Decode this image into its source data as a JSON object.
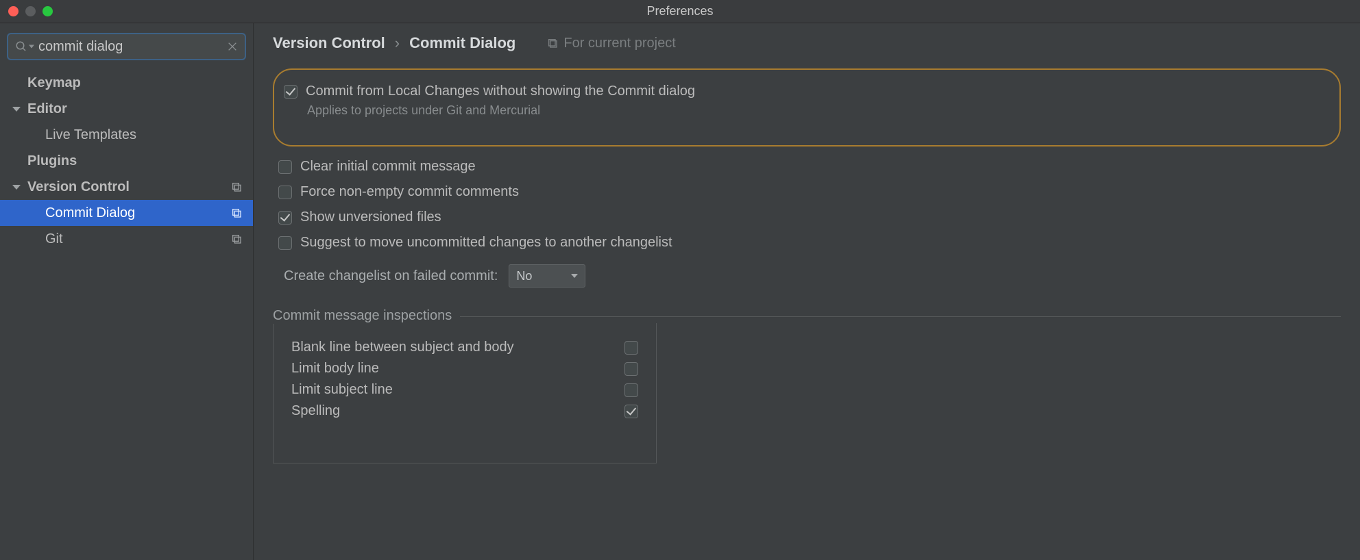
{
  "window": {
    "title": "Preferences"
  },
  "search": {
    "value": "commit dialog"
  },
  "sidebar": {
    "items": [
      {
        "label": "Keymap",
        "level": 1,
        "selected": false,
        "expandable": false,
        "scope": false
      },
      {
        "label": "Editor",
        "level": 1,
        "selected": false,
        "expandable": true,
        "scope": false
      },
      {
        "label": "Live Templates",
        "level": 2,
        "selected": false,
        "expandable": false,
        "scope": false
      },
      {
        "label": "Plugins",
        "level": 1,
        "selected": false,
        "expandable": false,
        "scope": false
      },
      {
        "label": "Version Control",
        "level": 1,
        "selected": false,
        "expandable": true,
        "scope": true
      },
      {
        "label": "Commit Dialog",
        "level": 2,
        "selected": true,
        "expandable": false,
        "scope": true
      },
      {
        "label": "Git",
        "level": 2,
        "selected": false,
        "expandable": false,
        "scope": true
      }
    ]
  },
  "breadcrumb": {
    "parent": "Version Control",
    "current": "Commit Dialog",
    "scope_hint": "For current project"
  },
  "settings": {
    "commit_from_local": {
      "label": "Commit from Local Changes without showing the Commit dialog",
      "checked": true
    },
    "commit_from_local_hint": "Applies to projects under Git and Mercurial",
    "clear_initial": {
      "label": "Clear initial commit message",
      "checked": false
    },
    "force_nonempty": {
      "label": "Force non-empty commit comments",
      "checked": false
    },
    "show_unversioned": {
      "label": "Show unversioned files",
      "checked": true
    },
    "suggest_move": {
      "label": "Suggest to move uncommitted changes to another changelist",
      "checked": false
    },
    "create_changelist_label": "Create changelist on failed commit:",
    "create_changelist_value": "No"
  },
  "inspections": {
    "title": "Commit message inspections",
    "items": [
      {
        "label": "Blank line between subject and body",
        "checked": false
      },
      {
        "label": "Limit body line",
        "checked": false
      },
      {
        "label": "Limit subject line",
        "checked": false
      },
      {
        "label": "Spelling",
        "checked": true
      }
    ]
  }
}
